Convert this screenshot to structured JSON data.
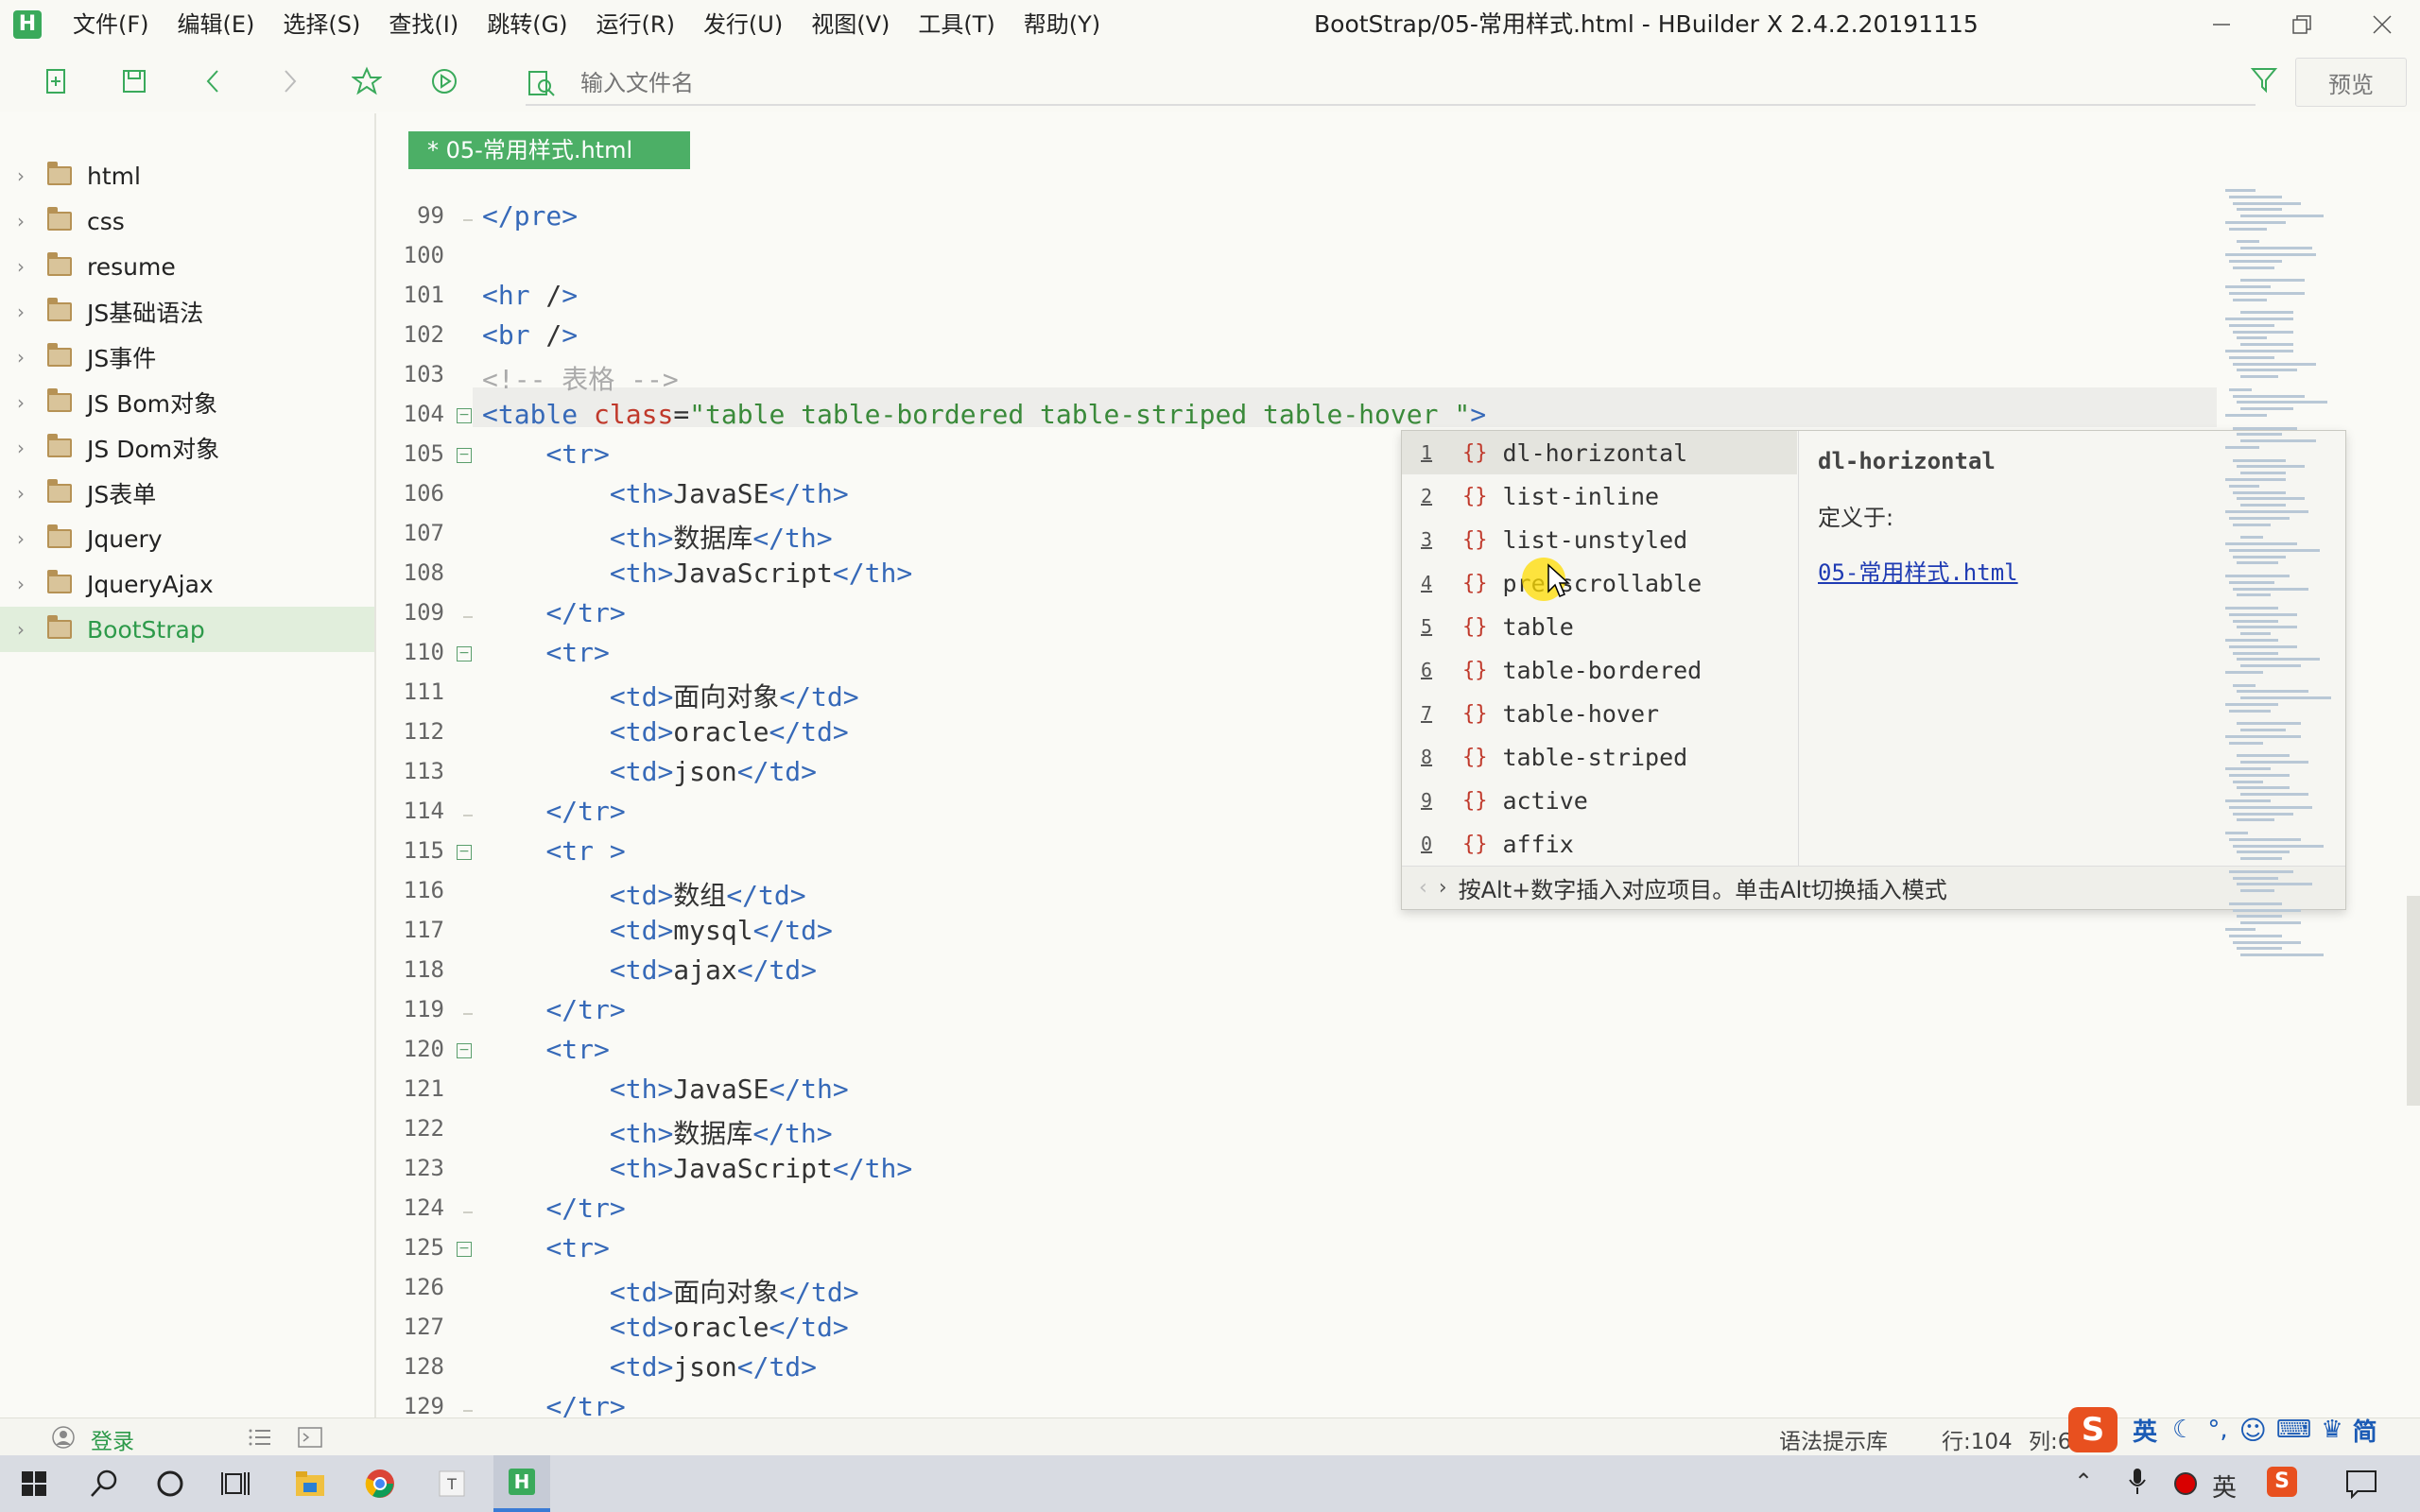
{
  "app": {
    "logo_letter": "H",
    "window_title": "BootStrap/05-常用样式.html - HBuilder X 2.4.2.20191115",
    "accent": "#3aaa5b"
  },
  "menu": [
    "文件(F)",
    "编辑(E)",
    "选择(S)",
    "查找(I)",
    "跳转(G)",
    "运行(R)",
    "发行(U)",
    "视图(V)",
    "工具(T)",
    "帮助(Y)"
  ],
  "toolbar": {
    "search_placeholder": "输入文件名",
    "preview_label": "预览",
    "icons": [
      "new-file-icon",
      "save-icon",
      "back-icon",
      "forward-icon",
      "star-icon",
      "run-icon",
      "file-search-icon",
      "filter-icon"
    ]
  },
  "sidebar": {
    "items": [
      {
        "label": "html"
      },
      {
        "label": "css"
      },
      {
        "label": "resume"
      },
      {
        "label": "JS基础语法"
      },
      {
        "label": "JS事件"
      },
      {
        "label": "JS Bom对象"
      },
      {
        "label": "JS Dom对象"
      },
      {
        "label": "JS表单"
      },
      {
        "label": "Jquery"
      },
      {
        "label": "JqueryAjax"
      },
      {
        "label": "BootStrap"
      }
    ],
    "active": "BootStrap"
  },
  "editor": {
    "tab_label": "* 05-常用样式.html",
    "line_numbers": [
      "99",
      "100",
      "101",
      "102",
      "103",
      "104",
      "105",
      "106",
      "107",
      "108",
      "109",
      "110",
      "111",
      "112",
      "113",
      "114",
      "115",
      "116",
      "117",
      "118",
      "119",
      "120",
      "121",
      "122",
      "123",
      "124",
      "125",
      "126",
      "127",
      "128",
      "129"
    ],
    "current_line": "104",
    "code": [
      "</pre>",
      "",
      "<hr />",
      "<br />",
      "<!-- 表格 -->",
      "<table class=\"table table-bordered table-striped table-hover \">",
      "    <tr>",
      "        <th>JavaSE</th>",
      "        <th>数据库</th>",
      "        <th>JavaScript</th>",
      "    </tr>",
      "    <tr>",
      "        <td>面向对象</td>",
      "        <td>oracle</td>",
      "        <td>json</td>",
      "    </tr>",
      "    <tr >",
      "        <td>数组</td>",
      "        <td>mysql</td>",
      "        <td>ajax</td>",
      "    </tr>",
      "    <tr>",
      "        <th>JavaSE</th>",
      "        <th>数据库</th>",
      "        <th>JavaScript</th>",
      "    </tr>",
      "    <tr>",
      "        <td>面向对象</td>",
      "        <td>oracle</td>",
      "        <td>json</td>",
      "    </tr>"
    ]
  },
  "autocomplete": {
    "items": [
      {
        "num": "1",
        "label": "dl-horizontal"
      },
      {
        "num": "2",
        "label": "list-inline"
      },
      {
        "num": "3",
        "label": "list-unstyled"
      },
      {
        "num": "4",
        "label": "pre-scrollable"
      },
      {
        "num": "5",
        "label": "table"
      },
      {
        "num": "6",
        "label": "table-bordered"
      },
      {
        "num": "7",
        "label": "table-hover"
      },
      {
        "num": "8",
        "label": "table-striped"
      },
      {
        "num": "9",
        "label": "active"
      },
      {
        "num": "0",
        "label": "affix"
      }
    ],
    "brace": "{}",
    "detail_title": "dl-horizontal",
    "detail_defined_in": "定义于:",
    "detail_link": "05-常用样式.html",
    "footer_hint": "按Alt+数字插入对应项目。单击Alt切换插入模式"
  },
  "status": {
    "login": "登录",
    "syntax_lib": "语法提示库",
    "line": "行:104",
    "col": "列:6"
  },
  "ime": {
    "lang": "英",
    "simplified": "简"
  }
}
